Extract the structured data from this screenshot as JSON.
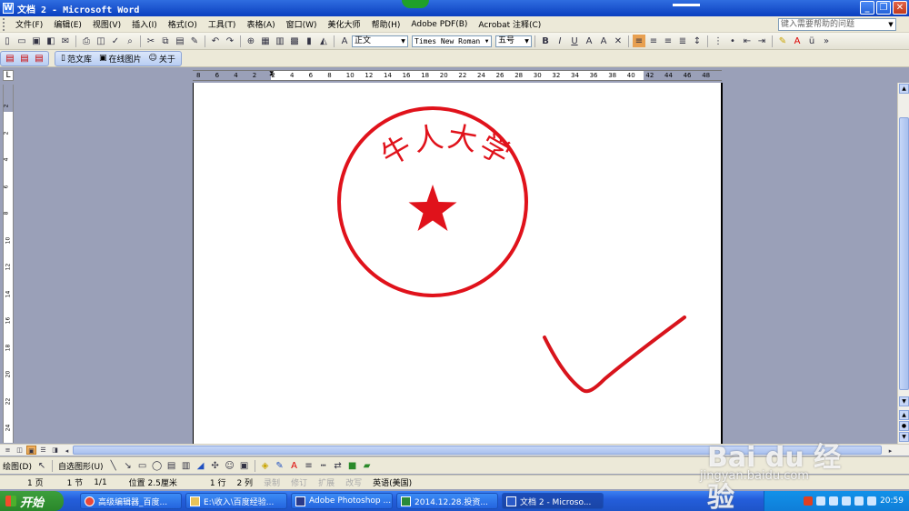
{
  "window": {
    "title": "文档 2 - Microsoft Word",
    "controls": [
      "_",
      "❐",
      "✕"
    ]
  },
  "menubar": {
    "items": [
      "文件(F)",
      "编辑(E)",
      "视图(V)",
      "插入(I)",
      "格式(O)",
      "工具(T)",
      "表格(A)",
      "窗口(W)",
      "美化大师",
      "帮助(H)",
      "Adobe PDF(B)",
      "Acrobat 注释(C)"
    ],
    "help_placeholder": "键入需要帮助的问题"
  },
  "formatting": {
    "style": "正文",
    "font": "Times New Roman",
    "size": "五号",
    "bold": "B",
    "italic": "I",
    "underline": "U"
  },
  "toolbar2": {
    "fanwenku": "范文库",
    "online_image": "在线图片",
    "about": "关于"
  },
  "ruler": {
    "labels": [
      "8",
      "6",
      "4",
      "2",
      "2",
      "4",
      "6",
      "8",
      "10",
      "12",
      "14",
      "16",
      "18",
      "20",
      "22",
      "24",
      "26",
      "28",
      "30",
      "32",
      "34",
      "36",
      "38",
      "40",
      "42",
      "44",
      "46",
      "48"
    ],
    "vlabels": [
      "2",
      "2",
      "4",
      "6",
      "8",
      "10",
      "12",
      "14",
      "16",
      "18",
      "20",
      "22",
      "24"
    ]
  },
  "document": {
    "seal_text": "牛人大学",
    "seal_color": "#e0121b"
  },
  "drawbar": {
    "draw_label": "绘图(D)",
    "autoshape_label": "自选图形(U)"
  },
  "statusbar": {
    "page": "1 页",
    "section": "1 节",
    "page_of": "1/1",
    "position": "位置 2.5厘米",
    "line": "1 行",
    "col": "2 列",
    "rec": "录制",
    "trk": "修订",
    "ext": "扩展",
    "ovr": "改写",
    "lang": "英语(美国)"
  },
  "taskbar": {
    "start": "开始",
    "tasks": [
      {
        "label": "高级编辑器_百度..."
      },
      {
        "label": "E:\\收入\\百度经验..."
      },
      {
        "label": "Adobe Photoshop ..."
      },
      {
        "label": "2014.12.28.投资..."
      },
      {
        "label": "文档 2 - Microso..."
      }
    ],
    "clock": "20:59"
  },
  "watermark": {
    "brand": "Bai du 经验",
    "url": "jingyan.baidu.com"
  }
}
